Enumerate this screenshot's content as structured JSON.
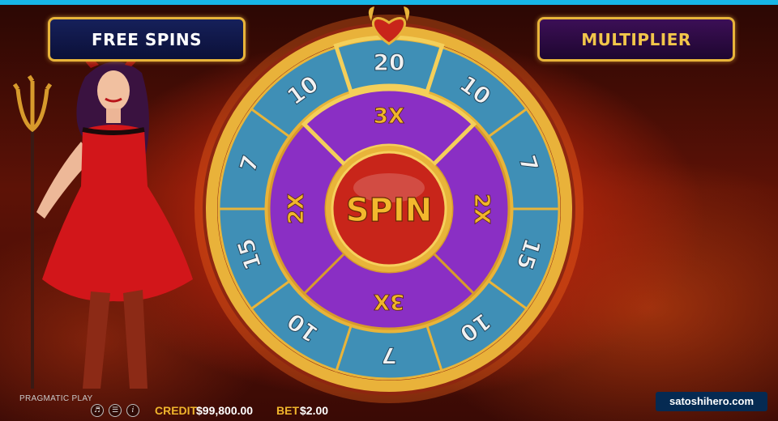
{
  "game": {
    "free_spins_label": "FREE SPINS",
    "multiplier_label": "MULTIPLIER",
    "spin_label": "SPIN"
  },
  "wheel": {
    "outer_segments": [
      "20",
      "10",
      "7",
      "15",
      "10",
      "7",
      "10",
      "15",
      "7",
      "10"
    ],
    "inner_segments": [
      "3X",
      "2X",
      "3X",
      "2X"
    ],
    "top_marker": "heart-marker-icon"
  },
  "footer": {
    "brand": "PRAGMATIC PLAY",
    "controls": [
      "speaker-icon",
      "menu-icon",
      "info-icon"
    ],
    "credit_label": "CREDIT",
    "credit_value": "$99,800.00",
    "bet_label": "BET",
    "bet_value": "$2.00"
  },
  "watermark": "satoshihero.com",
  "colors": {
    "accent_cyan": "#17b6e8",
    "gold": "#e8b43a",
    "wheel_outer_blue": "#3f8fb6",
    "wheel_inner_purple": "#8a2fc4",
    "spin_red": "#d22a1a"
  }
}
